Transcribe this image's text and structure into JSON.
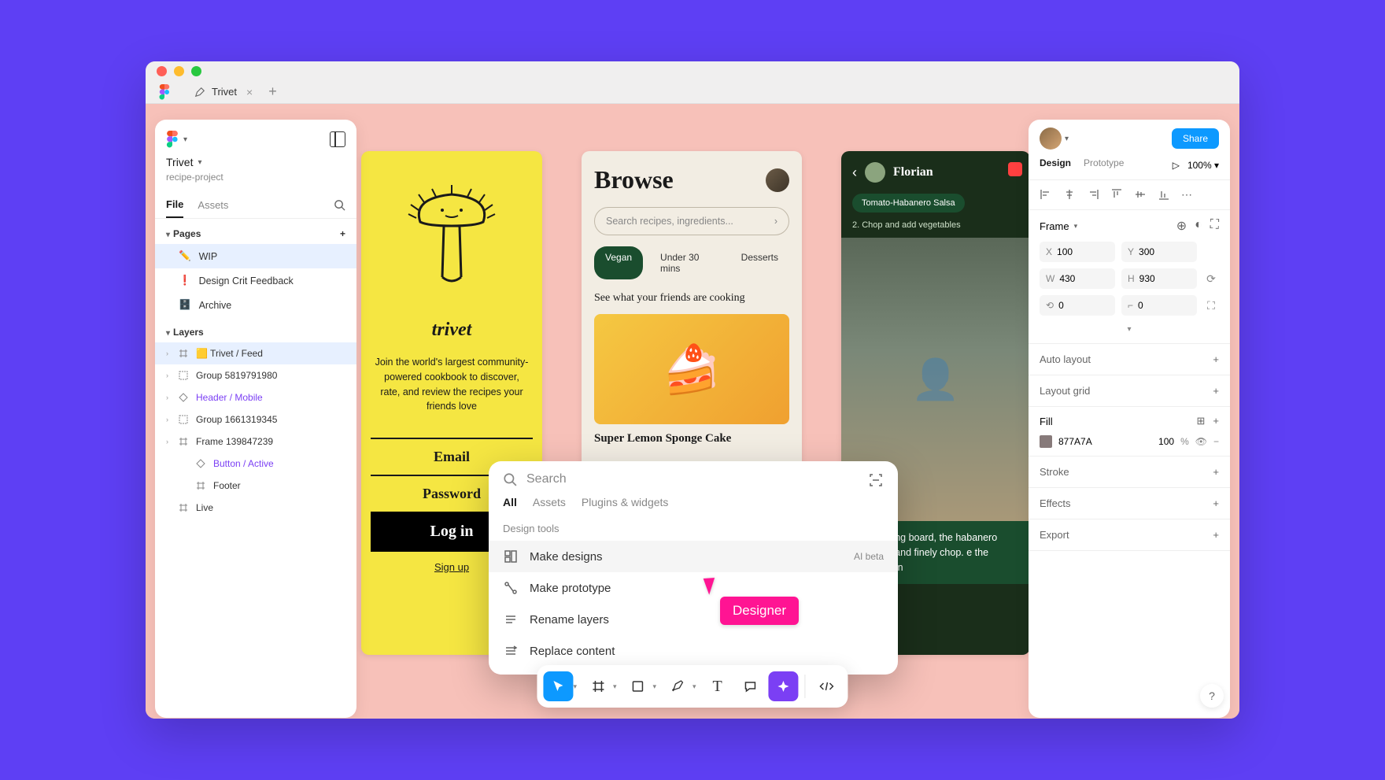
{
  "tab": {
    "name": "Trivet"
  },
  "leftPanel": {
    "project": "Trivet",
    "projectSub": "recipe-project",
    "fileTabs": [
      "File",
      "Assets"
    ],
    "sections": {
      "pages": "Pages",
      "layers": "Layers"
    },
    "pages": [
      {
        "icon": "✏️",
        "label": "WIP"
      },
      {
        "icon": "❗",
        "label": "Design Crit Feedback"
      },
      {
        "icon": "🗄️",
        "label": "Archive"
      }
    ],
    "layers": [
      {
        "label": "Trivet / Feed",
        "sel": true
      },
      {
        "label": "Group 5819791980"
      },
      {
        "label": "Header / Mobile",
        "purple": true
      },
      {
        "label": "Group 1661319345"
      },
      {
        "label": "Frame 139847239"
      },
      {
        "label": "Button / Active",
        "nested": true,
        "purple": true
      },
      {
        "label": "Footer",
        "nested": true
      },
      {
        "label": "Live"
      }
    ]
  },
  "artboards": {
    "trivet": {
      "logo": "trivet",
      "text": "Join the world's largest community-powered cookbook to discover, rate, and review the recipes your friends love",
      "email": "Email",
      "password": "Password",
      "login": "Log in",
      "signup": "Sign up"
    },
    "browse": {
      "title": "Browse",
      "searchPlaceholder": "Search recipes, ingredients...",
      "pills": [
        "Vegan",
        "Under 30 mins",
        "Desserts"
      ],
      "friends": "See what your friends are cooking",
      "recipe": "Super Lemon Sponge Cake"
    },
    "video": {
      "name": "Florian",
      "tag": "Tomato-Habanero Salsa",
      "step": "2. Chop and add vegetables",
      "caption": "large cutting board, the habanero stem eds and finely chop. e the onions then"
    }
  },
  "palette": {
    "searchPlaceholder": "Search",
    "tabs": [
      "All",
      "Assets",
      "Plugins & widgets"
    ],
    "section": "Design tools",
    "items": [
      {
        "label": "Make designs",
        "badge": "AI beta"
      },
      {
        "label": "Make prototype"
      },
      {
        "label": "Rename layers"
      },
      {
        "label": "Replace content"
      }
    ]
  },
  "cursor": {
    "label": "Designer"
  },
  "rightPanel": {
    "share": "Share",
    "tabs": [
      "Design",
      "Prototype"
    ],
    "zoom": "100%",
    "frame": "Frame",
    "x": "100",
    "y": "300",
    "w": "430",
    "h": "930",
    "r1": "0",
    "r2": "0",
    "autoLayout": "Auto layout",
    "layoutGrid": "Layout grid",
    "fill": {
      "label": "Fill",
      "hex": "877A7A",
      "opacity": "100",
      "unit": "%"
    },
    "stroke": "Stroke",
    "effects": "Effects",
    "export": "Export"
  }
}
